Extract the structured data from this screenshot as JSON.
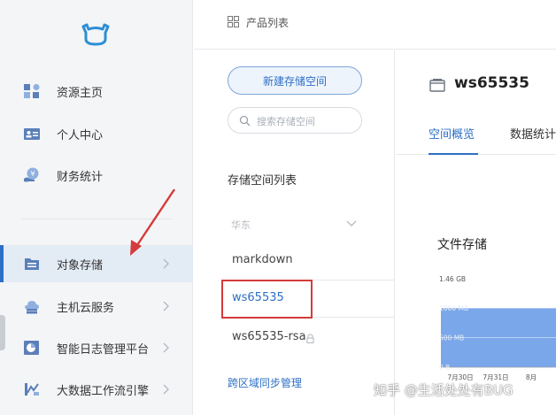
{
  "colors": {
    "accent": "#2d6fc5",
    "sidebar_bg": "#f4f5f7",
    "active_bg": "#e3ebf5",
    "highlight_red": "#d43b3b",
    "chart_fill": "#7aa7ea"
  },
  "header": {
    "breadcrumb": "产品列表",
    "breadcrumb_icon": "grid-icon"
  },
  "sidebar": {
    "logo_icon": "logo-icon",
    "items": [
      {
        "label": "资源主页",
        "icon": "dashboard-icon",
        "active": false,
        "has_chevron": false
      },
      {
        "label": "个人中心",
        "icon": "id-card-icon",
        "active": false,
        "has_chevron": false
      },
      {
        "label": "财务统计",
        "icon": "finance-icon",
        "active": false,
        "has_chevron": false
      },
      {
        "label": "对象存储",
        "icon": "folder-icon",
        "active": true,
        "has_chevron": true
      },
      {
        "label": "主机云服务",
        "icon": "server-icon",
        "active": false,
        "has_chevron": true
      },
      {
        "label": "智能日志管理平台",
        "icon": "pie-chart-icon",
        "active": false,
        "has_chevron": true
      },
      {
        "label": "大数据工作流引擎",
        "icon": "workflow-icon",
        "active": false,
        "has_chevron": true
      }
    ]
  },
  "storage_list": {
    "new_button": "新建存储空间",
    "search_placeholder": "搜索存储空间",
    "title": "存储空间列表",
    "region": "华东",
    "buckets": [
      {
        "name": "markdown",
        "selected": false,
        "locked": false
      },
      {
        "name": "ws65535",
        "selected": true,
        "locked": false
      },
      {
        "name": "ws65535-rsa",
        "selected": false,
        "locked": true
      }
    ],
    "cross_region": "跨区域同步管理"
  },
  "detail": {
    "bucket_name": "ws65535",
    "tabs": [
      {
        "label": "空间概览",
        "active": true
      },
      {
        "label": "数据统计",
        "active": false
      }
    ],
    "storage_title": "文件存储"
  },
  "chart_data": {
    "type": "area",
    "title": "",
    "y_ticks": [
      "1.46 GB",
      "1000 MB",
      "500 MB",
      "0 B"
    ],
    "y_tick_values": [
      1495,
      1000,
      500,
      0
    ],
    "x_ticks": [
      "7月30日",
      "7月31日",
      "8月"
    ],
    "ylim": [
      0,
      1495
    ],
    "series": [
      {
        "values": [
          1000,
          1000,
          1000
        ]
      }
    ],
    "grid": true
  },
  "watermark": "知乎 @生活处处有BUG"
}
